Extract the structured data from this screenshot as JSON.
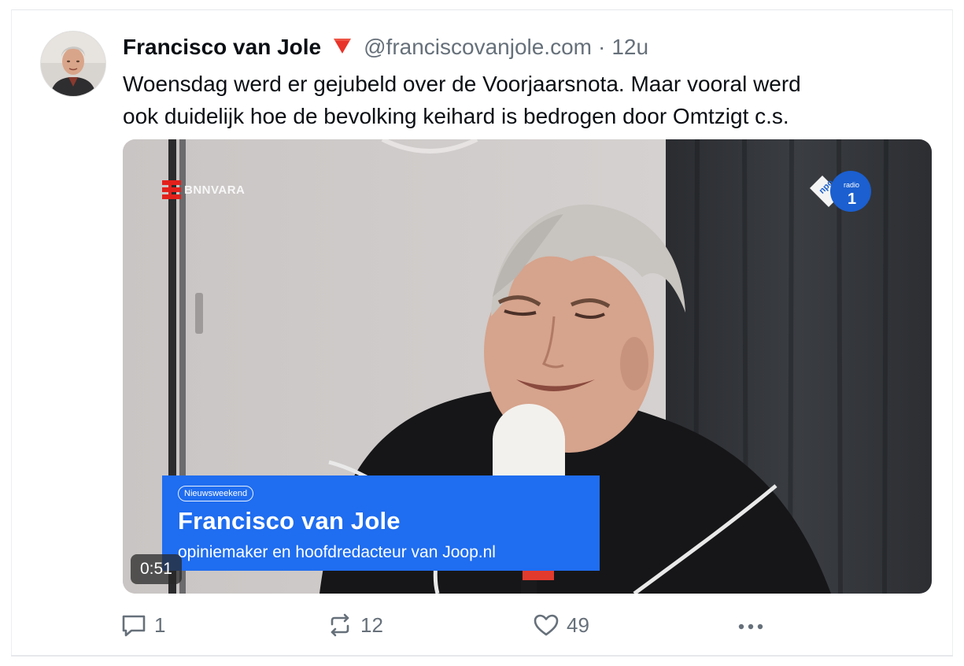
{
  "post": {
    "author_name": "Francisco van Jole",
    "author_handle": "@franciscovanjole.com",
    "separator": "·",
    "time_ago": "12u",
    "text_lines": [
      "Woensdag werd er gejubeld over de Voorjaarsnota. Maar vooral werd",
      "ook duidelijk hoe de bevolking keihard is bedrogen door Omtzigt c.s."
    ]
  },
  "video": {
    "channel_logo": "BNNVARA",
    "station_logo_text": "radio",
    "station_logo_number": "1",
    "station_logo_brand": "npo",
    "lower_third": {
      "tag": "Nieuwsweekend",
      "name": "Francisco van Jole",
      "title": "opiniemaker en hoofdredacteur van Joop.nl"
    },
    "duration": "0:51"
  },
  "actions": {
    "reply_count": "1",
    "repost_count": "12",
    "like_count": "49"
  },
  "icons": {
    "flag": "red-triangle-down-icon",
    "reply": "speech-bubble-icon",
    "repost": "repost-arrows-icon",
    "like": "heart-icon",
    "more": "ellipsis-icon"
  },
  "colors": {
    "text": "#0b0f14",
    "muted": "#66707a",
    "lower_third_blue": "#1f6df0",
    "flag_red": "#e8342a"
  }
}
